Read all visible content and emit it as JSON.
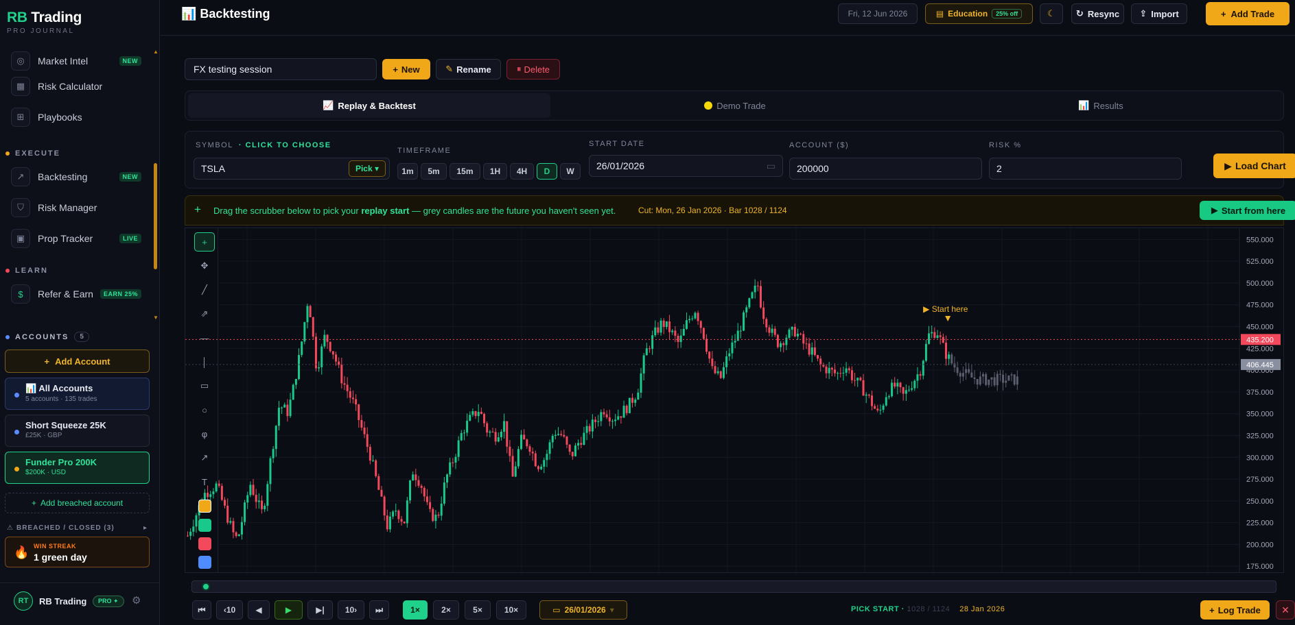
{
  "brand": {
    "name_rb": "RB",
    "name_rest": " Trading",
    "sub": "PRO JOURNAL"
  },
  "sidebar": {
    "items": [
      {
        "label": "Market Intel",
        "badge": "NEW",
        "icon": "globe-icon"
      },
      {
        "label": "Risk Calculator",
        "icon": "calculator-icon"
      },
      {
        "label": "Playbooks",
        "icon": "grid-icon"
      },
      {
        "label": "Backtesting",
        "badge": "NEW",
        "icon": "chart-line-icon"
      },
      {
        "label": "Risk Manager",
        "icon": "shield-icon"
      },
      {
        "label": "Prop Tracker",
        "badge": "LIVE",
        "icon": "briefcase-icon"
      },
      {
        "label": "Refer & Earn",
        "badge": "EARN 25%",
        "icon": "dollar-icon"
      }
    ],
    "sections": {
      "execute": "EXECUTE",
      "learn": "LEARN"
    }
  },
  "accounts": {
    "title": "ACCOUNTS",
    "count": "5",
    "add_label": "Add Account",
    "list": [
      {
        "title": "All Accounts",
        "sub": "5 accounts · 135 trades",
        "color": "#5b8cff"
      },
      {
        "title": "Short Squeeze 25K",
        "sub": "£25K · GBP",
        "color": "#5b8cff"
      },
      {
        "title": "Funder Pro 200K",
        "sub": "$200K · USD",
        "color": "#f0a818"
      }
    ],
    "add_breached": "Add breached account",
    "breached_head": "BREACHED / CLOSED (3)"
  },
  "streak": {
    "label": "WIN STREAK",
    "value": "1 green day"
  },
  "user": {
    "initials": "RT",
    "name": "RB Trading",
    "plan": "PRO ✦"
  },
  "header": {
    "title": "Backtesting",
    "date": "Fri, 12 Jun 2026",
    "edu_label": "Education",
    "edu_pill": "25% off",
    "resync": "Resync",
    "import": "Import",
    "add_trade": "Add Trade"
  },
  "session": {
    "name": "FX testing session",
    "new": "New",
    "rename": "Rename",
    "delete": "Delete"
  },
  "tabs": [
    "Replay & Backtest",
    "Demo Trade",
    "Results"
  ],
  "params": {
    "symbol_label": "SYMBOL",
    "symbol_hint": "· CLICK TO CHOOSE",
    "symbol": "TSLA",
    "pick": "Pick ▾",
    "timeframe_label": "TIMEFRAME",
    "timeframes": [
      "1m",
      "5m",
      "15m",
      "1H",
      "4H",
      "D",
      "W"
    ],
    "timeframe_active": "D",
    "start_label": "START DATE",
    "start": "26/01/2026",
    "account_label": "ACCOUNT ($)",
    "account": "200000",
    "risk_label": "RISK %",
    "risk": "2",
    "load": "Load Chart"
  },
  "banner": {
    "msg_pre": "Drag the scrubber below to pick your ",
    "msg_bold": "replay start",
    "msg_post": " — grey candles are the future you haven't seen yet.",
    "cut": "Cut: Mon, 26 Jan 2026 · Bar 1028 / 1124",
    "start_btn": "Start from here"
  },
  "chart_data": {
    "type": "candlestick",
    "symbol": "TSLA",
    "timeframe": "D",
    "y_ticks": [
      "550.000",
      "525.000",
      "500.000",
      "475.000",
      "450.000",
      "425.000",
      "400.000",
      "375.000",
      "350.000",
      "325.000",
      "300.000",
      "275.000",
      "250.000",
      "225.000",
      "200.000",
      "175.000"
    ],
    "ylim": [
      170,
      555
    ],
    "price_line": "435.200",
    "last_price": "406.445",
    "marker_label": "▶ Start here",
    "cut_bar": 1028,
    "total_bars": 1124,
    "colors": {
      "up": "#19c98b",
      "down": "#f2495c",
      "future": "#5a5e6e"
    },
    "path": [
      [
        0,
        210
      ],
      [
        0.02,
        258
      ],
      [
        0.035,
        268
      ],
      [
        0.05,
        225
      ],
      [
        0.055,
        212
      ],
      [
        0.06,
        205
      ],
      [
        0.075,
        270
      ],
      [
        0.085,
        245
      ],
      [
        0.09,
        235
      ],
      [
        0.1,
        300
      ],
      [
        0.11,
        360
      ],
      [
        0.12,
        352
      ],
      [
        0.125,
        370
      ],
      [
        0.135,
        420
      ],
      [
        0.145,
        485
      ],
      [
        0.155,
        400
      ],
      [
        0.165,
        440
      ],
      [
        0.175,
        420
      ],
      [
        0.185,
        390
      ],
      [
        0.2,
        360
      ],
      [
        0.21,
        330
      ],
      [
        0.22,
        300
      ],
      [
        0.23,
        260
      ],
      [
        0.24,
        220
      ],
      [
        0.25,
        240
      ],
      [
        0.26,
        225
      ],
      [
        0.27,
        285
      ],
      [
        0.28,
        270
      ],
      [
        0.29,
        235
      ],
      [
        0.3,
        230
      ],
      [
        0.31,
        275
      ],
      [
        0.32,
        300
      ],
      [
        0.33,
        330
      ],
      [
        0.34,
        345
      ],
      [
        0.35,
        355
      ],
      [
        0.36,
        330
      ],
      [
        0.37,
        325
      ],
      [
        0.38,
        340
      ],
      [
        0.39,
        275
      ],
      [
        0.4,
        320
      ],
      [
        0.41,
        315
      ],
      [
        0.42,
        290
      ],
      [
        0.43,
        300
      ],
      [
        0.44,
        330
      ],
      [
        0.45,
        325
      ],
      [
        0.46,
        300
      ],
      [
        0.47,
        318
      ],
      [
        0.48,
        330
      ],
      [
        0.49,
        342
      ],
      [
        0.5,
        355
      ],
      [
        0.51,
        345
      ],
      [
        0.52,
        350
      ],
      [
        0.53,
        360
      ],
      [
        0.54,
        375
      ],
      [
        0.55,
        420
      ],
      [
        0.56,
        440
      ],
      [
        0.57,
        455
      ],
      [
        0.58,
        445
      ],
      [
        0.59,
        430
      ],
      [
        0.6,
        455
      ],
      [
        0.61,
        470
      ],
      [
        0.62,
        440
      ],
      [
        0.63,
        400
      ],
      [
        0.64,
        390
      ],
      [
        0.65,
        420
      ],
      [
        0.66,
        440
      ],
      [
        0.67,
        465
      ],
      [
        0.68,
        490
      ],
      [
        0.685,
        497
      ],
      [
        0.69,
        468
      ],
      [
        0.7,
        445
      ],
      [
        0.71,
        430
      ],
      [
        0.72,
        440
      ],
      [
        0.73,
        445
      ],
      [
        0.74,
        430
      ],
      [
        0.75,
        420
      ],
      [
        0.76,
        405
      ],
      [
        0.77,
        400
      ],
      [
        0.78,
        395
      ],
      [
        0.79,
        405
      ],
      [
        0.8,
        390
      ],
      [
        0.81,
        380
      ],
      [
        0.82,
        365
      ],
      [
        0.83,
        348
      ],
      [
        0.84,
        375
      ],
      [
        0.85,
        382
      ],
      [
        0.86,
        370
      ],
      [
        0.87,
        385
      ],
      [
        0.88,
        400
      ],
      [
        0.89,
        440
      ],
      [
        0.9,
        445
      ],
      [
        0.91,
        420
      ],
      [
        0.92,
        405
      ],
      [
        0.93,
        398
      ],
      [
        0.94,
        392
      ],
      [
        0.95,
        389
      ]
    ]
  },
  "replay": {
    "skip_back_10": "‹10",
    "skip_fwd_10": "10›",
    "speeds": [
      "1×",
      "2×",
      "5×",
      "10×"
    ],
    "speed_active": "1×",
    "date": "26/01/2026",
    "pick_start": "PICK START ·",
    "bar_status": "1028 / 1124",
    "bar_date": "28 Jan 2026",
    "log_trade": "Log Trade"
  }
}
